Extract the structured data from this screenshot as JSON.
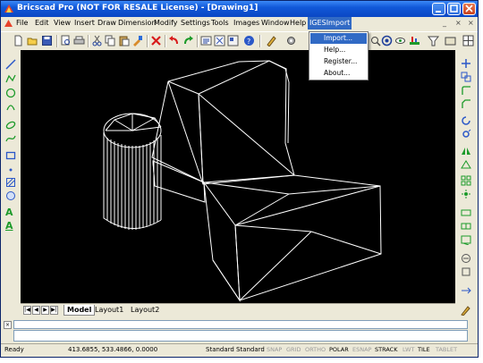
{
  "window": {
    "title": "Bricscad Pro (NOT FOR RESALE License) - [Drawing1]",
    "controls": [
      "minimize-icon",
      "maximize-icon",
      "close-icon"
    ]
  },
  "menu": {
    "items": [
      "File",
      "Edit",
      "View",
      "Insert",
      "Draw",
      "Dimension",
      "Modify",
      "Settings",
      "Tools",
      "Images",
      "Window",
      "Help",
      "IGESImport"
    ],
    "active": "IGESImport",
    "mdi_controls": [
      "_",
      "×",
      "×"
    ]
  },
  "dropdown": {
    "items": [
      "Import...",
      "Help...",
      "Register...",
      "About..."
    ],
    "highlighted": "Import..."
  },
  "layout_tabs": {
    "tabs": [
      "Model",
      "Layout1",
      "Layout2"
    ],
    "active": "Model",
    "nav_buttons": [
      "first",
      "prev",
      "next",
      "last"
    ]
  },
  "command_line": {
    "close_glyph": "×",
    "history": "",
    "input": ""
  },
  "status": {
    "state": "Ready",
    "coordinates": "413.6855, 533.4866, 0.0000",
    "text_style": "Standard",
    "dim_style": "Standard",
    "toggles": [
      {
        "label": "SNAP",
        "on": false
      },
      {
        "label": "GRID",
        "on": false
      },
      {
        "label": "ORTHO",
        "on": false
      },
      {
        "label": "POLAR",
        "on": true
      },
      {
        "label": "ESNAP",
        "on": false
      },
      {
        "label": "STRACK",
        "on": true
      },
      {
        "label": "LWT",
        "on": false
      },
      {
        "label": "TILE",
        "on": true
      },
      {
        "label": "TABLET",
        "on": false
      }
    ]
  },
  "colors": {
    "titlebar": "#0a47c4",
    "menu_highlight": "#316ac5",
    "canvas": "#000000",
    "drawing_lines": "#ffffff",
    "chrome": "#ece9d8"
  }
}
